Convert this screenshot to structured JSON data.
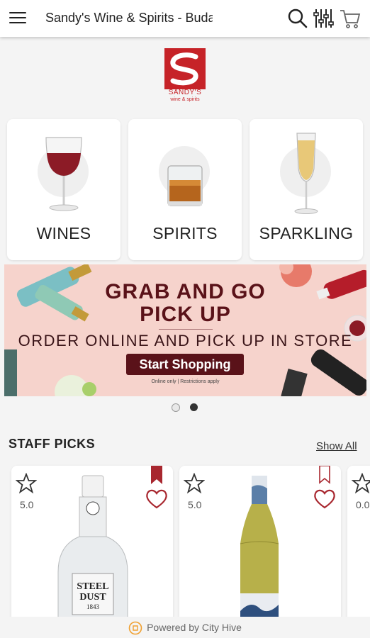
{
  "header": {
    "title": "Sandy's Wine & Spirits - Buda",
    "icons": [
      "menu-icon",
      "search-icon",
      "filter-icon",
      "cart-icon"
    ]
  },
  "logo": {
    "brand": "SANDY'S",
    "tagline": "wine & spirits"
  },
  "categories": [
    {
      "label": "WINES",
      "icon": "wine-glass-icon"
    },
    {
      "label": "SPIRITS",
      "icon": "whiskey-glass-icon"
    },
    {
      "label": "SPARKLING",
      "icon": "champagne-flute-icon"
    }
  ],
  "banner": {
    "headline_1": "GRAB AND GO",
    "headline_2": "PICK UP",
    "subheadline": "ORDER ONLINE AND PICK UP IN STORE",
    "button_label": "Start Shopping",
    "fine_print": "Online only | Restrictions apply"
  },
  "carousel": {
    "total": 2,
    "active_index": 1
  },
  "staff_picks": {
    "title": "STAFF PICKS",
    "show_all_label": "Show All",
    "products": [
      {
        "rating": "5.0",
        "label_text_1": "STEEL",
        "label_text_2": "DUST",
        "label_year": "1843",
        "bookmarked": true
      },
      {
        "rating": "5.0",
        "bookmarked": false
      },
      {
        "rating": "0.0",
        "bookmarked": false
      }
    ]
  },
  "footer": {
    "text": "Powered by City Hive"
  },
  "colors": {
    "brand": "#c62328",
    "banner_bg": "#f6d3cc",
    "banner_text": "#5a1219",
    "heart": "#a8272f"
  }
}
